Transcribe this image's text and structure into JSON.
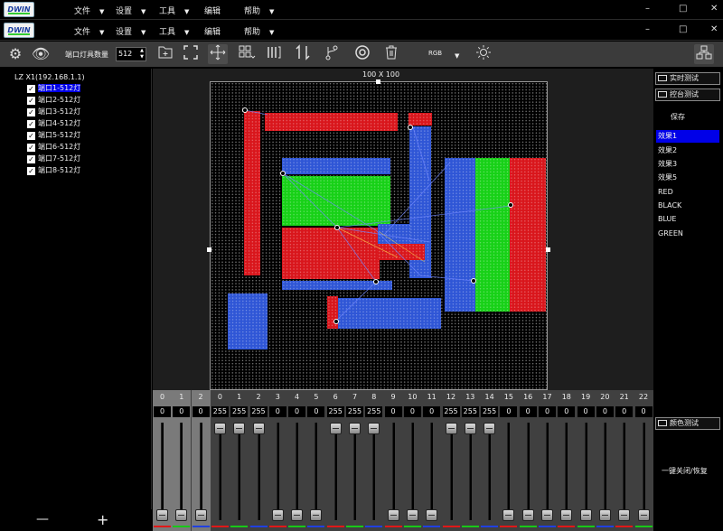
{
  "menubar": {
    "logo_text": "DWIN",
    "items": [
      "文件",
      "设置",
      "工具",
      "编辑",
      "帮助"
    ],
    "window_controls": [
      "–",
      "□",
      "✕"
    ]
  },
  "toolbar": {
    "lamp_count_label": "端口灯具数量",
    "lamp_count_value": "512",
    "color_mode": "RGB",
    "icons": [
      "gear-icon",
      "eye-icon",
      "add-file-icon",
      "fullscreen-icon",
      "move-icon",
      "grid-icon",
      "columns-icon",
      "swap-icon",
      "branch-icon",
      "target-icon",
      "trash-icon",
      "brightness-icon",
      "layout-icon"
    ]
  },
  "tree": {
    "root": "LZ X1(192.168.1.1)",
    "items": [
      "端口1-512灯",
      "端口2-512灯",
      "端口3-512灯",
      "端口4-512灯",
      "端口5-512灯",
      "端口6-512灯",
      "端口7-512灯",
      "端口8-512灯"
    ],
    "selected_index": 0
  },
  "bottom_controls": {
    "minus": "—",
    "plus": "+"
  },
  "canvas": {
    "size_label": "100 X 100"
  },
  "right_panel": {
    "realtime_test": "实时测试",
    "console_test": "控台测试",
    "save": "保存",
    "effects": [
      "效果1",
      "效果2",
      "效果3",
      "效果5",
      "RED",
      "BLACK",
      "BLUE",
      "GREEN"
    ],
    "selected_effect": 0,
    "color_test": "颜色测试",
    "one_key": "一键关闭/恢复"
  },
  "mixer": {
    "channels": [
      {
        "n": "0",
        "v": "0",
        "active": true
      },
      {
        "n": "1",
        "v": "0",
        "active": true
      },
      {
        "n": "2",
        "v": "0",
        "active": true
      },
      {
        "n": "0",
        "v": "255"
      },
      {
        "n": "1",
        "v": "255"
      },
      {
        "n": "2",
        "v": "255"
      },
      {
        "n": "3",
        "v": "0"
      },
      {
        "n": "4",
        "v": "0"
      },
      {
        "n": "5",
        "v": "0"
      },
      {
        "n": "6",
        "v": "255"
      },
      {
        "n": "7",
        "v": "255"
      },
      {
        "n": "8",
        "v": "255"
      },
      {
        "n": "9",
        "v": "0"
      },
      {
        "n": "10",
        "v": "0"
      },
      {
        "n": "11",
        "v": "0"
      },
      {
        "n": "12",
        "v": "255"
      },
      {
        "n": "13",
        "v": "255"
      },
      {
        "n": "14",
        "v": "255"
      },
      {
        "n": "15",
        "v": "0"
      },
      {
        "n": "16",
        "v": "0"
      },
      {
        "n": "17",
        "v": "0"
      },
      {
        "n": "18",
        "v": "0"
      },
      {
        "n": "19",
        "v": "0"
      },
      {
        "n": "20",
        "v": "0"
      },
      {
        "n": "21",
        "v": "0"
      },
      {
        "n": "22",
        "v": "0"
      }
    ],
    "colors": {
      "red": "#e01818",
      "green": "#18c818",
      "blue": "#2040e0"
    }
  }
}
